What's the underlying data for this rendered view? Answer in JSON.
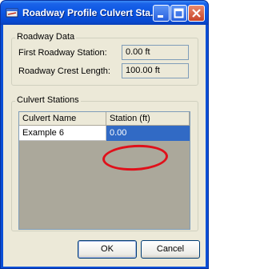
{
  "window": {
    "title": "Roadway Profile Culvert Sta..."
  },
  "roadway_data": {
    "group_label": "Roadway Data",
    "first_station_label": "First Roadway Station:",
    "first_station_value": "0.00 ft",
    "crest_length_label": "Roadway Crest Length:",
    "crest_length_value": "100.00 ft"
  },
  "culvert_stations": {
    "group_label": "Culvert Stations",
    "columns": [
      "Culvert Name",
      "Station (ft)"
    ],
    "rows": [
      {
        "name": "Example 6",
        "station": "0.00"
      }
    ]
  },
  "buttons": {
    "ok": "OK",
    "cancel": "Cancel"
  },
  "colors": {
    "title_bar": "#0a55e3",
    "selection": "#316ac5",
    "highlight_ellipse": "#e0101a"
  }
}
